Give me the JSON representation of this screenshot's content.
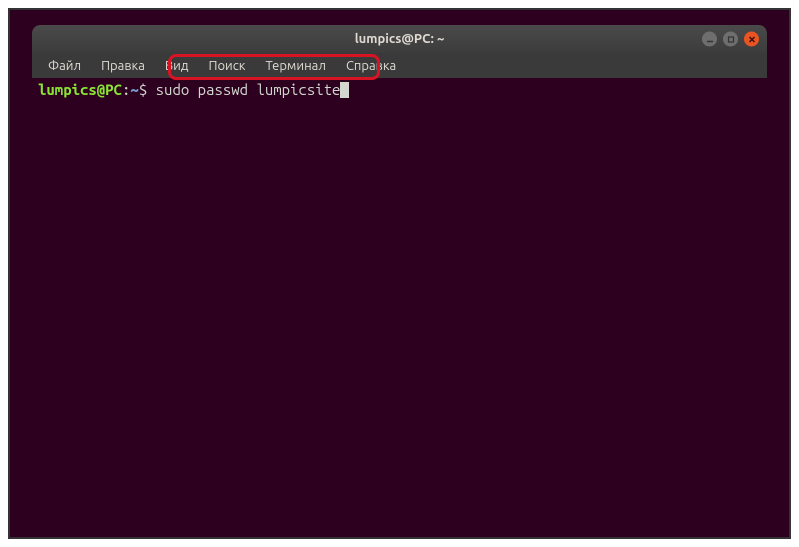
{
  "window": {
    "title": "lumpics@PC: ~"
  },
  "menubar": {
    "file": "Файл",
    "edit": "Правка",
    "view": "Вид",
    "search": "Поиск",
    "terminal": "Терминал",
    "help": "Справка"
  },
  "prompt": {
    "user_host": "lumpics@PC",
    "colon": ":",
    "path": "~",
    "dollar": "$"
  },
  "command": "sudo passwd lumpicsite"
}
